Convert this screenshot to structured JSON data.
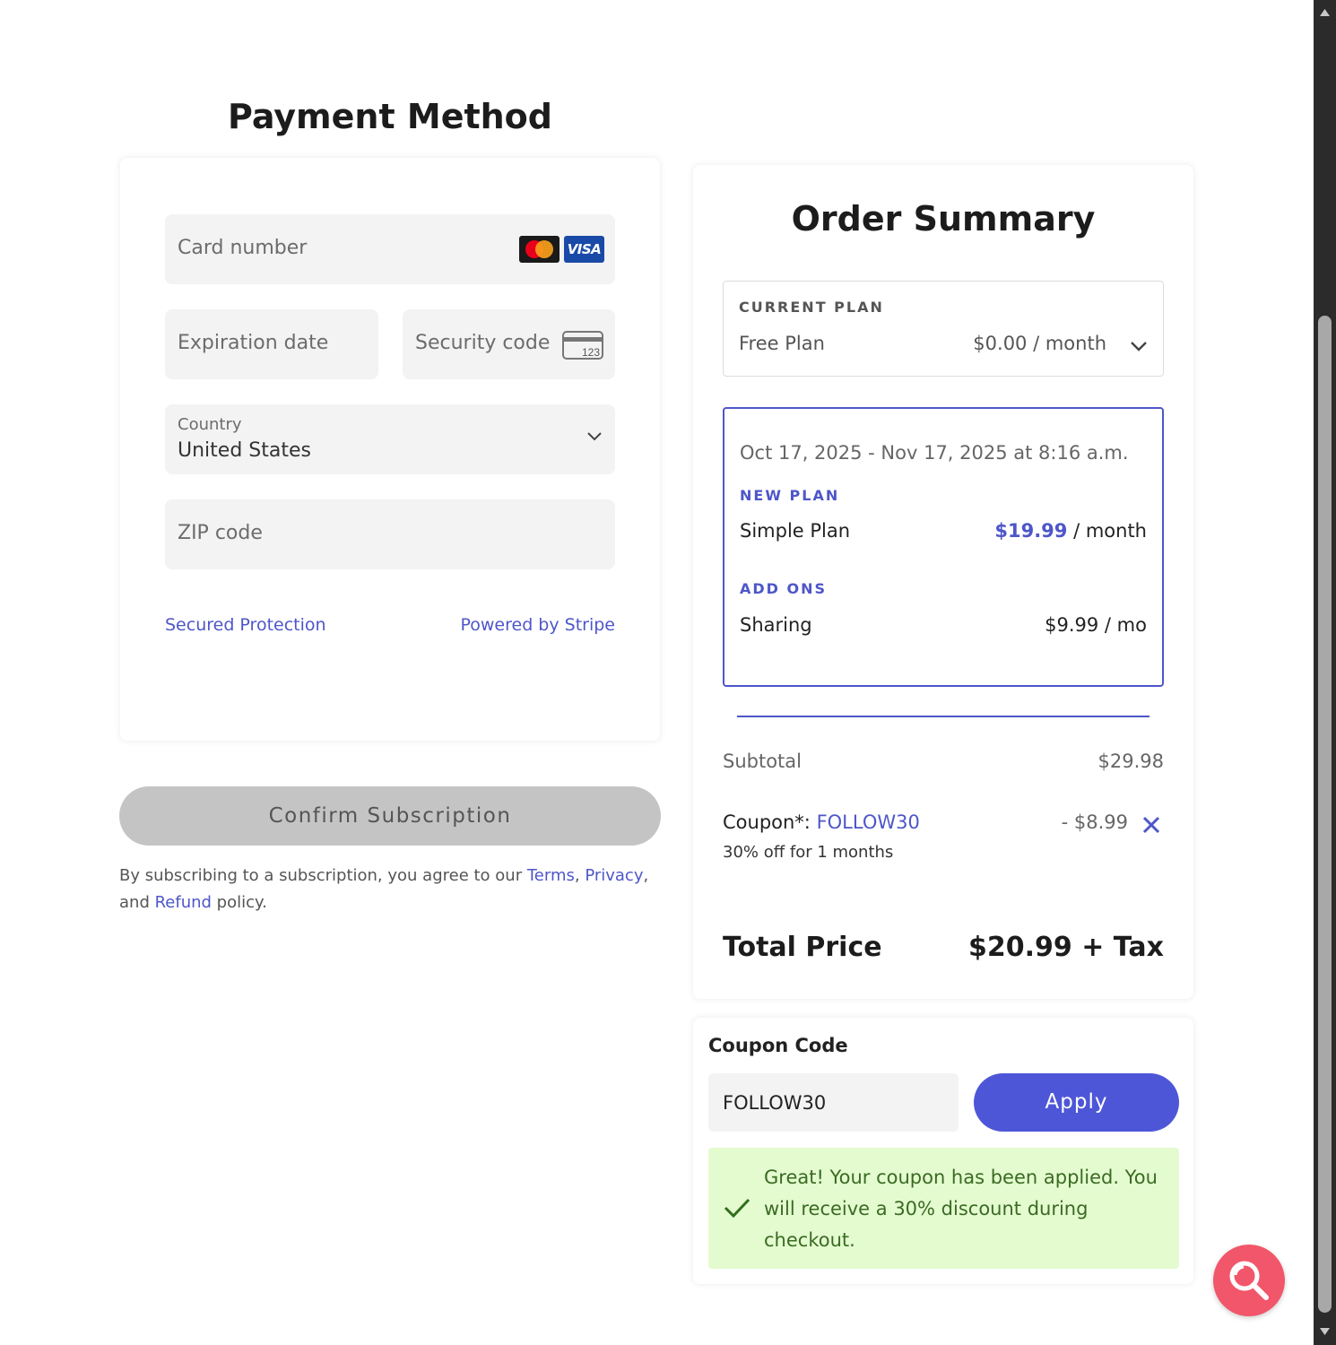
{
  "payment_method": {
    "title": "Payment Method",
    "card_number_placeholder": "Card number",
    "card_brands": [
      "mastercard-icon",
      "visa-icon"
    ],
    "visa_label": "VISA",
    "expiration_placeholder": "Expiration date",
    "security_placeholder": "Security code",
    "security_icon_label": "123",
    "country_label": "Country",
    "country_value": "United States",
    "zip_placeholder": "ZIP code",
    "secured_link": "Secured Protection",
    "stripe_link": "Powered by Stripe"
  },
  "confirm": {
    "button_label": "Confirm Subscription",
    "terms_prefix": "By subscribing to a subscription, you agree to our ",
    "terms_link": "Terms",
    "comma": ", ",
    "privacy_link": "Privacy",
    "and_text": ", and ",
    "refund_link": "Refund",
    "suffix": " policy."
  },
  "order_summary": {
    "title": "Order Summary",
    "current_plan": {
      "caption": "CURRENT PLAN",
      "name": "Free Plan",
      "price": "$0.00 / month"
    },
    "new_plan": {
      "dates": "Oct 17, 2025 - Nov 17, 2025 at 8:16 a.m.",
      "caption": "NEW PLAN",
      "name": "Simple Plan",
      "price_amount": "$19.99",
      "price_suffix": " / month",
      "addons_caption": "ADD ONS",
      "addon_name": "Sharing",
      "addon_price": "$9.99 / mo"
    },
    "subtotal_label": "Subtotal",
    "subtotal_value": "$29.98",
    "coupon_label": "Coupon*: ",
    "coupon_code": "FOLLOW30",
    "coupon_value": "- $8.99",
    "coupon_desc": "30% off for 1 months",
    "total_label": "Total Price",
    "total_value": "$20.99 + Tax"
  },
  "coupon_code": {
    "title": "Coupon Code",
    "input_value": "FOLLOW30",
    "apply_label": "Apply",
    "success_message": "Great! Your coupon has been applied. You will receive a 30% discount during checkout."
  },
  "colors": {
    "accent": "#4e56c9",
    "button_primary": "#4e56d8",
    "success_bg": "#e4fbd0",
    "fab": "#f2566a"
  }
}
